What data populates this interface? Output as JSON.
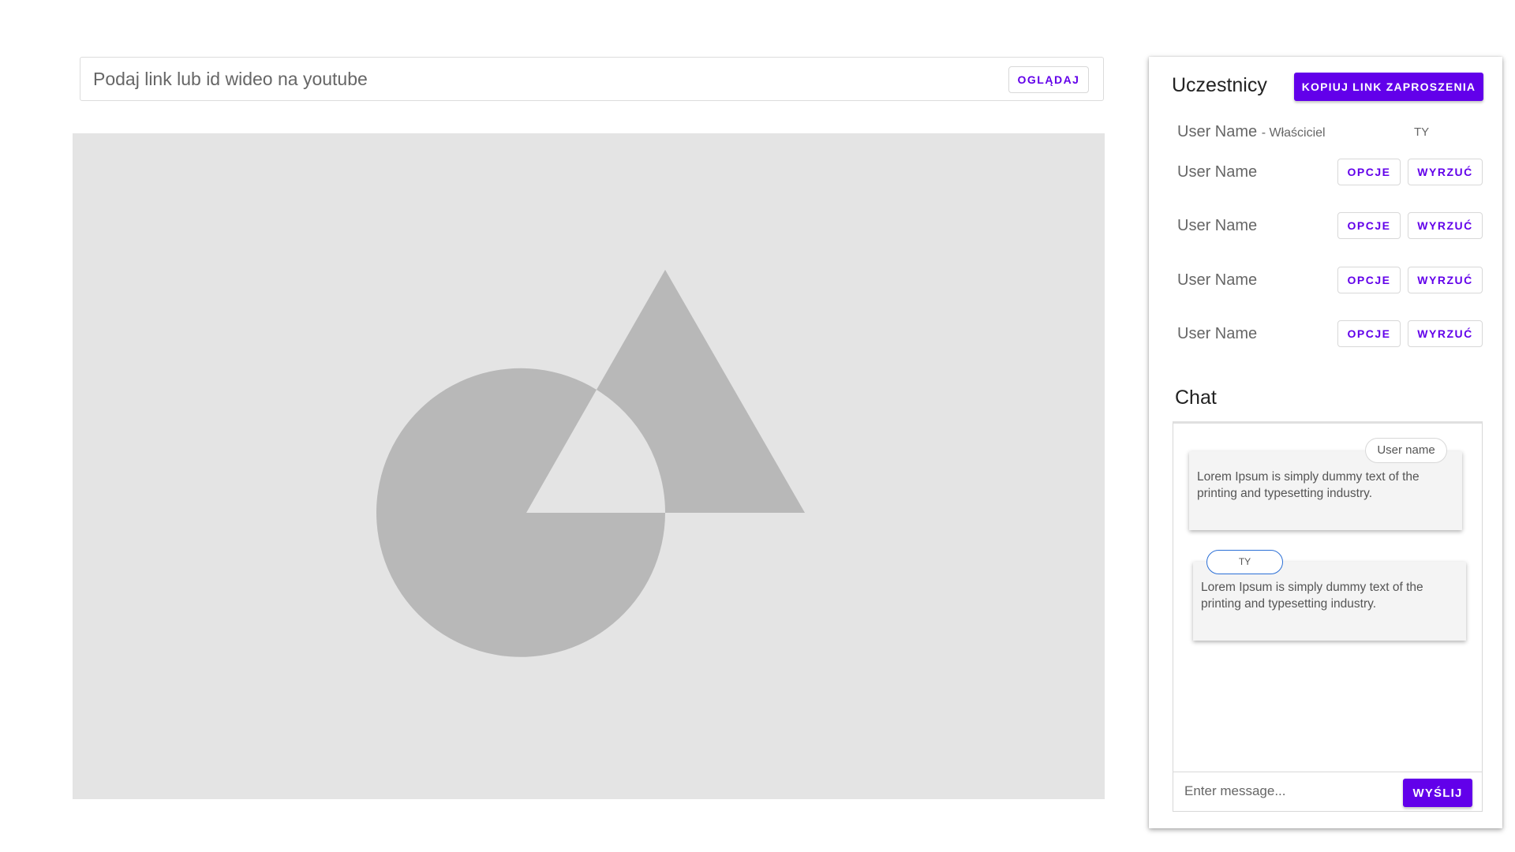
{
  "video_search": {
    "placeholder": "Podaj link lub id wideo na youtube",
    "watch_label": "OGLĄDAJ"
  },
  "player": {
    "icon": "image-placeholder-icon"
  },
  "participants": {
    "title": "Uczestnicy",
    "invite_label": "KOPIUJ LINK ZAPROSZENIA",
    "owner": {
      "name": "User Name",
      "role": "- Właściciel",
      "you_tag": "TY"
    },
    "users": [
      {
        "name": "User Name",
        "options_label": "OPCJE",
        "kick_label": "WYRZUĆ"
      },
      {
        "name": "User Name",
        "options_label": "OPCJE",
        "kick_label": "WYRZUĆ"
      },
      {
        "name": "User Name",
        "options_label": "OPCJE",
        "kick_label": "WYRZUĆ"
      },
      {
        "name": "User Name",
        "options_label": "OPCJE",
        "kick_label": "WYRZUĆ"
      }
    ]
  },
  "chat": {
    "title": "Chat",
    "messages": [
      {
        "author": "User name",
        "text": "Lorem Ipsum is simply dummy text of the printing and typesetting industry."
      },
      {
        "author": "TY",
        "text": "Lorem Ipsum is simply dummy text of the printing and typesetting industry."
      }
    ],
    "input_placeholder": "Enter message...",
    "send_label": "WYŚLIJ"
  },
  "colors": {
    "accent": "#6200ea",
    "player_bg": "#e4e4e4",
    "placeholder_shape": "#b8b8b8",
    "self_outline": "#2b6fd6"
  }
}
